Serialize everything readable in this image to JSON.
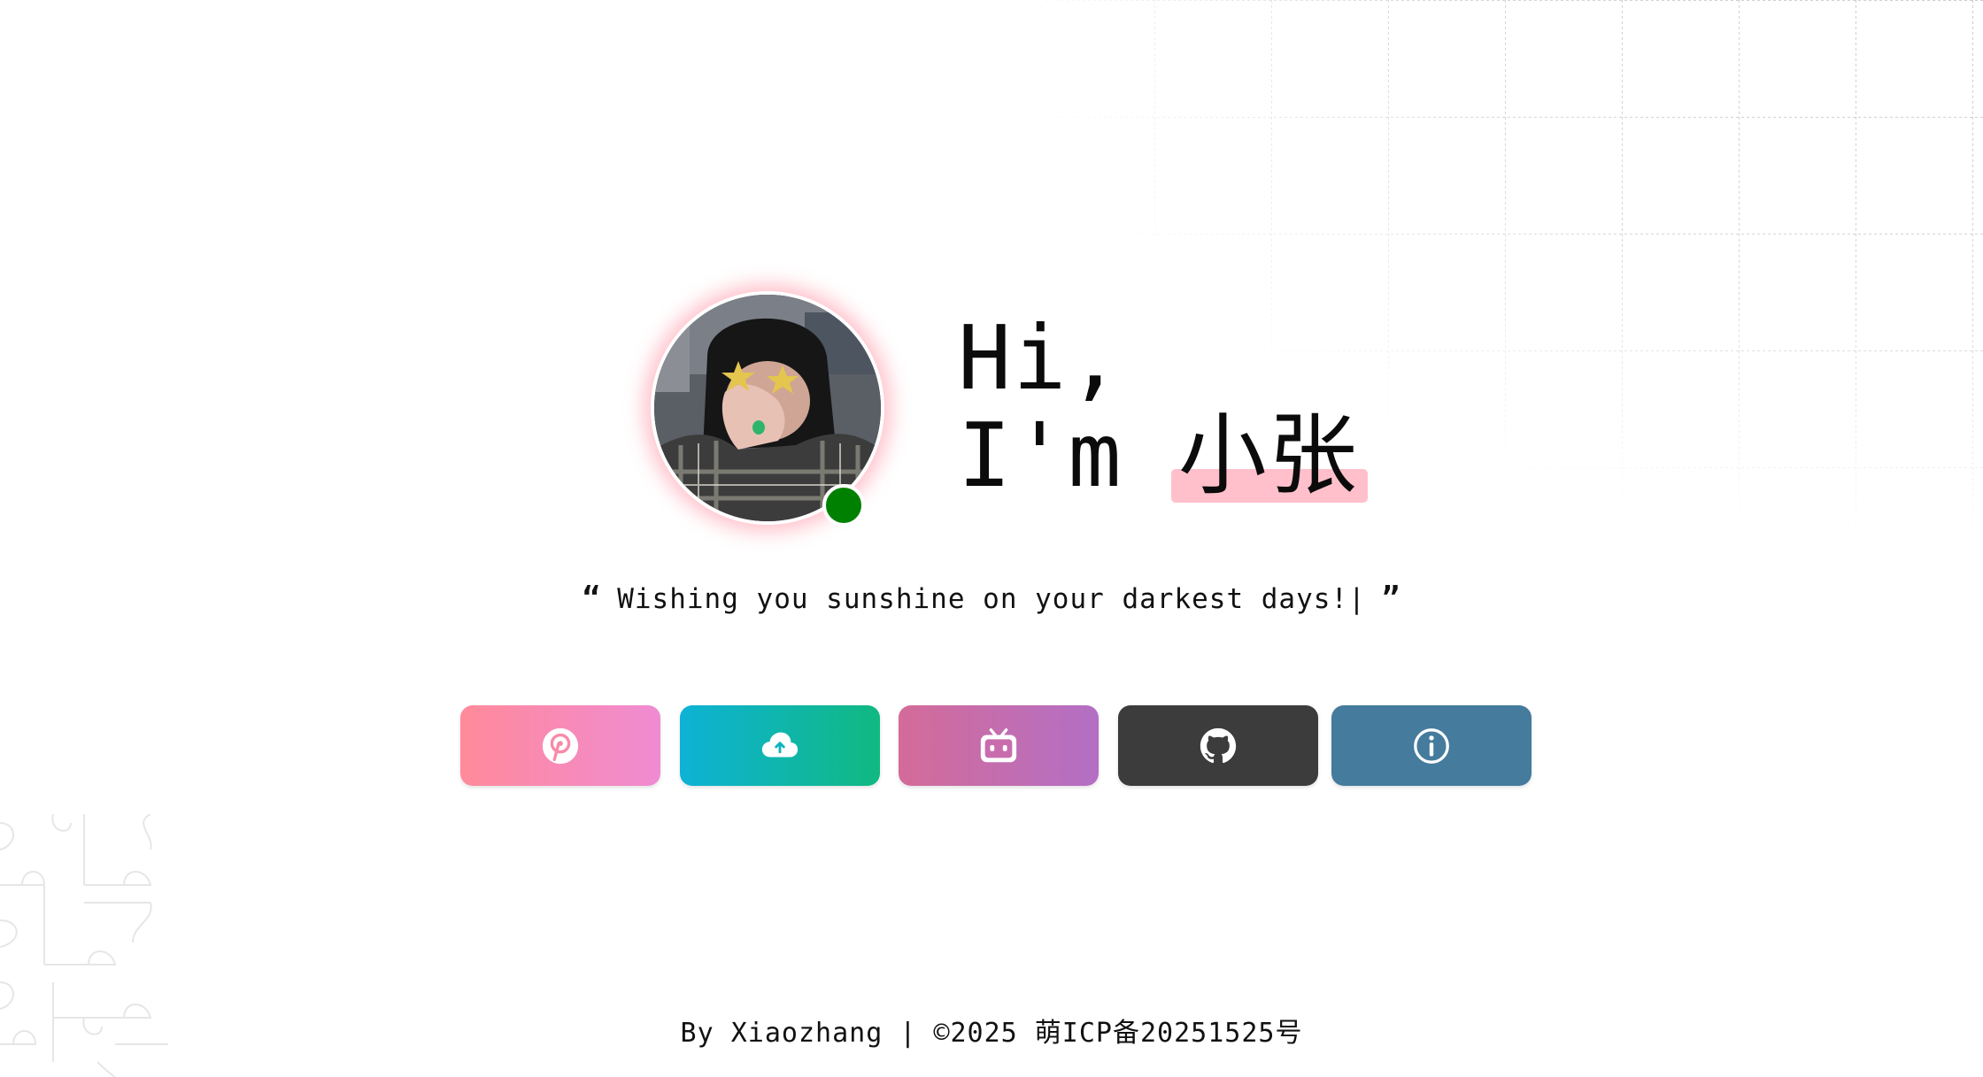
{
  "hero": {
    "greeting_line1": "Hi,",
    "greeting_prefix": "I'm ",
    "name": "小张",
    "status": "online",
    "status_color": "#008000",
    "highlight_color": "#ffc0cb"
  },
  "quote": {
    "open": "“",
    "text": "Wishing you sunshine on your darkest days!|",
    "close": "”"
  },
  "buttons": [
    {
      "name": "blog-button",
      "icon": "pinterest-icon",
      "gradient": [
        "#ff8a9a",
        "#f08bd2"
      ]
    },
    {
      "name": "cloud-button",
      "icon": "cloud-upload-icon",
      "gradient": [
        "#0eb2d6",
        "#10b981"
      ]
    },
    {
      "name": "bilibili-button",
      "icon": "bilibili-icon",
      "gradient": [
        "#d46b99",
        "#b36fc5"
      ]
    },
    {
      "name": "github-button",
      "icon": "github-icon",
      "gradient": [
        "#3c3c3c",
        "#3c3c3c"
      ]
    },
    {
      "name": "info-button",
      "icon": "info-icon",
      "gradient": [
        "#457b9d",
        "#457b9d"
      ]
    }
  ],
  "footer": {
    "text": "By Xiaozhang | ©2025 萌ICP备20251525号"
  }
}
